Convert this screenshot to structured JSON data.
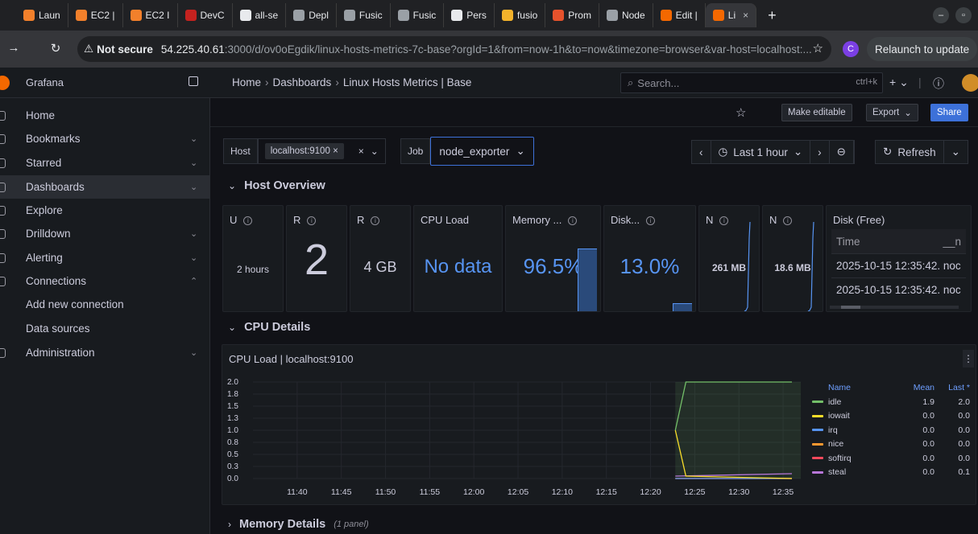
{
  "browser": {
    "tabs": [
      {
        "label": "Laun",
        "color": "#f2802b"
      },
      {
        "label": "EC2 |",
        "color": "#f2802b"
      },
      {
        "label": "EC2 I",
        "color": "#f2802b"
      },
      {
        "label": "DevC",
        "color": "#c5221f"
      },
      {
        "label": "all-se",
        "color": "#e8eaed"
      },
      {
        "label": "Depl",
        "color": "#9aa0a6"
      },
      {
        "label": "Fusic",
        "color": "#9aa0a6"
      },
      {
        "label": "Fusic",
        "color": "#9aa0a6"
      },
      {
        "label": "Pers",
        "color": "#e8eaed"
      },
      {
        "label": "fusio",
        "color": "#f2b22b"
      },
      {
        "label": "Prom",
        "color": "#e6522c"
      },
      {
        "label": "Node",
        "color": "#9aa0a6"
      },
      {
        "label": "Edit |",
        "color": "#f46800"
      },
      {
        "label": "Li",
        "color": "#f46800"
      }
    ],
    "not_secure": "Not secure",
    "url_host": "54.225.40.61",
    "url_rest": ":3000/d/ov0oEgdik/linux-hosts-metrics-7c-base?orgId=1&from=now-1h&to=now&timezone=browser&var-host=localhost:...",
    "profile_initial": "C",
    "relaunch_label": "Relaunch to update"
  },
  "grafana": {
    "app_title": "Grafana",
    "breadcrumbs": [
      "Home",
      "Dashboards",
      "Linux Hosts Metrics | Base"
    ],
    "search_placeholder": "Search...",
    "search_shortcut": "ctrl+k",
    "sidebar": [
      {
        "label": "Home",
        "chev": ""
      },
      {
        "label": "Bookmarks",
        "chev": "⌄"
      },
      {
        "label": "Starred",
        "chev": "⌄"
      },
      {
        "label": "Dashboards",
        "chev": "⌄",
        "active": true
      },
      {
        "label": "Explore",
        "chev": ""
      },
      {
        "label": "Drilldown",
        "chev": "⌄"
      },
      {
        "label": "Alerting",
        "chev": "⌄"
      },
      {
        "label": "Connections",
        "chev": "⌃"
      },
      {
        "label": "Add new connection",
        "chev": ""
      },
      {
        "label": "Data sources",
        "chev": ""
      },
      {
        "label": "Administration",
        "chev": "⌄"
      }
    ],
    "toolbar": {
      "make_editable": "Make editable",
      "export": "Export",
      "share": "Share"
    },
    "vars": {
      "host_label": "Host",
      "host_value": "localhost:9100",
      "job_label": "Job",
      "job_value": "node_exporter"
    },
    "time": {
      "range": "Last 1 hour",
      "refresh": "Refresh"
    },
    "rows": {
      "host_overview": "Host Overview",
      "cpu_details": "CPU Details",
      "memory_details": "Memory Details",
      "memory_sub": "(1 panel)"
    },
    "stat_panels": [
      {
        "title": "U",
        "value": "2 hours",
        "kind": "text"
      },
      {
        "title": "R",
        "value": "2",
        "kind": "big"
      },
      {
        "title": "R",
        "value": "4 GB",
        "kind": "mid"
      },
      {
        "title": "CPU Load",
        "value": "No data",
        "kind": "nodata"
      },
      {
        "title": "Memory ...",
        "value": "96.5%",
        "kind": "pct"
      },
      {
        "title": "Disk...",
        "value": "13.0%",
        "kind": "pct"
      },
      {
        "title": "N",
        "value": "261 MB",
        "kind": "small"
      },
      {
        "title": "N",
        "value": "18.6 MB",
        "kind": "small"
      }
    ],
    "disk_free": {
      "title": "Disk (Free)",
      "col_time": "Time",
      "col2": "__n",
      "rows": [
        "2025-10-15 12:35:42.",
        "2025-10-15 12:35:42."
      ],
      "row_suffix": "noc"
    },
    "cpu_panel": {
      "title": "CPU Load | localhost:9100"
    }
  },
  "chart_data": {
    "type": "line",
    "title": "CPU Load | localhost:9100",
    "x_ticks": [
      "11:40",
      "11:45",
      "11:50",
      "11:55",
      "12:00",
      "12:05",
      "12:10",
      "12:15",
      "12:20",
      "12:25",
      "12:30",
      "12:35"
    ],
    "y_ticks": [
      "0.0",
      "0.3",
      "0.5",
      "0.8",
      "1.0",
      "1.3",
      "1.5",
      "1.8",
      "2.0"
    ],
    "ylim": [
      0,
      2.0
    ],
    "legend_headers": [
      "Name",
      "Mean",
      "Last *"
    ],
    "series": [
      {
        "name": "idle",
        "color": "#73bf69",
        "mean": "1.9",
        "last": "2.0",
        "points": [
          [
            12.38,
            1.0
          ],
          [
            12.4,
            2.0
          ],
          [
            12.6,
            2.0
          ]
        ]
      },
      {
        "name": "iowait",
        "color": "#fade2a",
        "mean": "0.0",
        "last": "0.0",
        "points": [
          [
            12.38,
            1.0
          ],
          [
            12.4,
            0.05
          ],
          [
            12.6,
            0.0
          ]
        ]
      },
      {
        "name": "irq",
        "color": "#5794f2",
        "mean": "0.0",
        "last": "0.0",
        "points": [
          [
            12.38,
            0.0
          ],
          [
            12.6,
            0.0
          ]
        ]
      },
      {
        "name": "nice",
        "color": "#ff9830",
        "mean": "0.0",
        "last": "0.0",
        "points": [
          [
            12.38,
            0.0
          ],
          [
            12.6,
            0.0
          ]
        ]
      },
      {
        "name": "softirq",
        "color": "#f2495c",
        "mean": "0.0",
        "last": "0.0",
        "points": [
          [
            12.38,
            0.0
          ],
          [
            12.6,
            0.0
          ]
        ]
      },
      {
        "name": "steal",
        "color": "#b877d9",
        "mean": "0.0",
        "last": "0.1",
        "points": [
          [
            12.38,
            0.05
          ],
          [
            12.6,
            0.1
          ]
        ]
      }
    ]
  }
}
